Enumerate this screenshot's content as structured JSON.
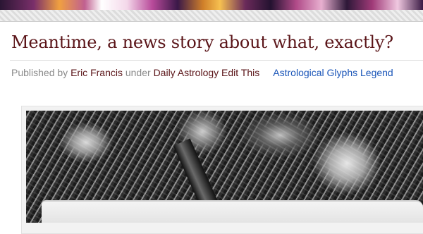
{
  "post": {
    "title": "Meantime, a news story about what, exactly?",
    "meta": {
      "published_by_label": "Published by",
      "author": "Eric Francis",
      "under_label": "under",
      "category": "Daily Astrology",
      "edit_link": "Edit This",
      "glyphs_link": "Astrological Glyphs Legend"
    }
  },
  "colors": {
    "title": "#5a1418",
    "meta_text": "#8a8a8a",
    "link_dark": "#5a1418",
    "link_blue": "#1a55b8"
  }
}
